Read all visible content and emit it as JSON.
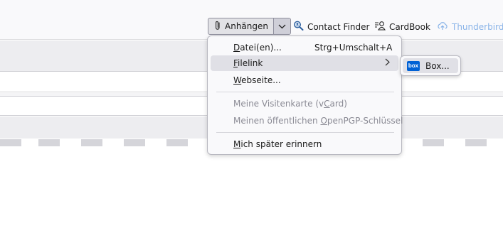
{
  "toolbar": {
    "attach_label": "Anhängen",
    "contact_finder_label": "Contact Finder",
    "cardbook_label": "CardBook",
    "thunderbird_label": "Thunderbird S"
  },
  "attach_menu": {
    "items": [
      {
        "label_pre": "",
        "label_u": "D",
        "label_post": "atei(en)...",
        "shortcut": "Strg+Umschalt+A",
        "state": "normal"
      },
      {
        "label_pre": "",
        "label_u": "F",
        "label_post": "ilelink",
        "shortcut": "",
        "state": "active",
        "has_submenu": true
      },
      {
        "label_pre": "",
        "label_u": "W",
        "label_post": "ebseite...",
        "shortcut": "",
        "state": "normal"
      },
      {
        "label_pre": "Meine Visitenkarte (v",
        "label_u": "C",
        "label_post": "ard)",
        "shortcut": "",
        "state": "disabled"
      },
      {
        "label_pre": "Meinen öffentlichen ",
        "label_u": "O",
        "label_post": "penPGP-Schlüssel",
        "shortcut": "",
        "state": "disabled"
      },
      {
        "label_pre": "",
        "label_u": "M",
        "label_post": "ich später erinnern",
        "shortcut": "",
        "state": "normal"
      }
    ]
  },
  "filelink_submenu": {
    "items": [
      {
        "logo_text": "box",
        "label": "Box..."
      }
    ]
  },
  "colors": {
    "menu_bg": "#f9f9fb",
    "active_bg": "#e0e0e6",
    "box_brand": "#0061d5",
    "disabled_text": "#8a8a94"
  }
}
